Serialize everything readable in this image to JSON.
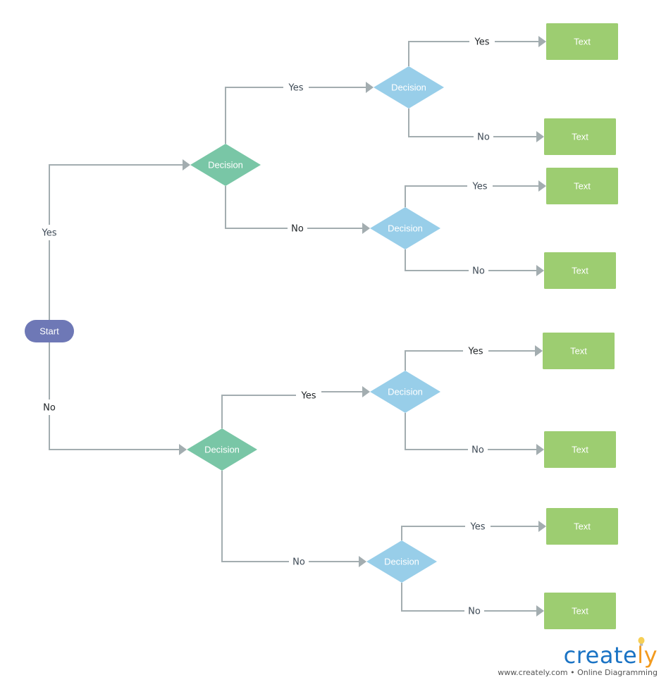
{
  "diagram": {
    "colors": {
      "start": "#6e78b6",
      "decision_primary": "#79c6a6",
      "decision_secondary": "#98cee9",
      "terminal": "#9dcd71",
      "connector": "#a3adb0"
    },
    "nodes": {
      "start": {
        "label": "Start"
      },
      "d_yes": {
        "label": "Decision"
      },
      "d_no": {
        "label": "Decision"
      },
      "d_yy": {
        "label": "Decision"
      },
      "d_yn": {
        "label": "Decision"
      },
      "d_ny": {
        "label": "Decision"
      },
      "d_nn": {
        "label": "Decision"
      },
      "t1": {
        "label": "Text"
      },
      "t2": {
        "label": "Text"
      },
      "t3": {
        "label": "Text"
      },
      "t4": {
        "label": "Text"
      },
      "t5": {
        "label": "Text"
      },
      "t6": {
        "label": "Text"
      },
      "t7": {
        "label": "Text"
      },
      "t8": {
        "label": "Text"
      }
    },
    "edges": [
      {
        "from": "start",
        "to": "d_yes",
        "label": "Yes"
      },
      {
        "from": "start",
        "to": "d_no",
        "label": "No"
      },
      {
        "from": "d_yes",
        "to": "d_yy",
        "label": "Yes"
      },
      {
        "from": "d_yes",
        "to": "d_yn",
        "label": "No"
      },
      {
        "from": "d_yy",
        "to": "t1",
        "label": "Yes"
      },
      {
        "from": "d_yy",
        "to": "t2",
        "label": "No"
      },
      {
        "from": "d_yn",
        "to": "t3",
        "label": "Yes"
      },
      {
        "from": "d_yn",
        "to": "t4",
        "label": "No"
      },
      {
        "from": "d_no",
        "to": "d_ny",
        "label": "Yes"
      },
      {
        "from": "d_no",
        "to": "d_nn",
        "label": "No"
      },
      {
        "from": "d_ny",
        "to": "t5",
        "label": "Yes"
      },
      {
        "from": "d_ny",
        "to": "t6",
        "label": "No"
      },
      {
        "from": "d_nn",
        "to": "t7",
        "label": "Yes"
      },
      {
        "from": "d_nn",
        "to": "t8",
        "label": "No"
      }
    ]
  },
  "branding": {
    "logo_main": "create",
    "logo_accent": "ly",
    "tagline": "www.creately.com • Online Diagramming"
  }
}
